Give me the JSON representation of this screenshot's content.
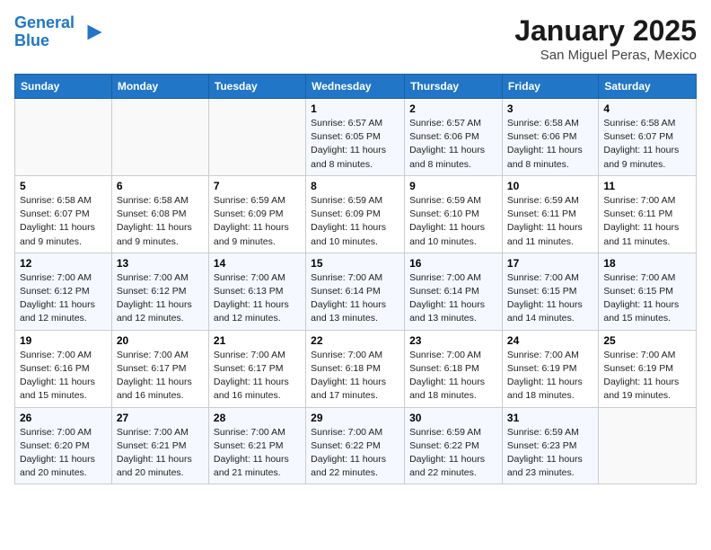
{
  "header": {
    "logo_line1": "General",
    "logo_line2": "Blue",
    "month_year": "January 2025",
    "location": "San Miguel Peras, Mexico"
  },
  "weekdays": [
    "Sunday",
    "Monday",
    "Tuesday",
    "Wednesday",
    "Thursday",
    "Friday",
    "Saturday"
  ],
  "weeks": [
    [
      {
        "day": "",
        "info": ""
      },
      {
        "day": "",
        "info": ""
      },
      {
        "day": "",
        "info": ""
      },
      {
        "day": "1",
        "info": "Sunrise: 6:57 AM\nSunset: 6:05 PM\nDaylight: 11 hours and 8 minutes."
      },
      {
        "day": "2",
        "info": "Sunrise: 6:57 AM\nSunset: 6:06 PM\nDaylight: 11 hours and 8 minutes."
      },
      {
        "day": "3",
        "info": "Sunrise: 6:58 AM\nSunset: 6:06 PM\nDaylight: 11 hours and 8 minutes."
      },
      {
        "day": "4",
        "info": "Sunrise: 6:58 AM\nSunset: 6:07 PM\nDaylight: 11 hours and 9 minutes."
      }
    ],
    [
      {
        "day": "5",
        "info": "Sunrise: 6:58 AM\nSunset: 6:07 PM\nDaylight: 11 hours and 9 minutes."
      },
      {
        "day": "6",
        "info": "Sunrise: 6:58 AM\nSunset: 6:08 PM\nDaylight: 11 hours and 9 minutes."
      },
      {
        "day": "7",
        "info": "Sunrise: 6:59 AM\nSunset: 6:09 PM\nDaylight: 11 hours and 9 minutes."
      },
      {
        "day": "8",
        "info": "Sunrise: 6:59 AM\nSunset: 6:09 PM\nDaylight: 11 hours and 10 minutes."
      },
      {
        "day": "9",
        "info": "Sunrise: 6:59 AM\nSunset: 6:10 PM\nDaylight: 11 hours and 10 minutes."
      },
      {
        "day": "10",
        "info": "Sunrise: 6:59 AM\nSunset: 6:11 PM\nDaylight: 11 hours and 11 minutes."
      },
      {
        "day": "11",
        "info": "Sunrise: 7:00 AM\nSunset: 6:11 PM\nDaylight: 11 hours and 11 minutes."
      }
    ],
    [
      {
        "day": "12",
        "info": "Sunrise: 7:00 AM\nSunset: 6:12 PM\nDaylight: 11 hours and 12 minutes."
      },
      {
        "day": "13",
        "info": "Sunrise: 7:00 AM\nSunset: 6:12 PM\nDaylight: 11 hours and 12 minutes."
      },
      {
        "day": "14",
        "info": "Sunrise: 7:00 AM\nSunset: 6:13 PM\nDaylight: 11 hours and 12 minutes."
      },
      {
        "day": "15",
        "info": "Sunrise: 7:00 AM\nSunset: 6:14 PM\nDaylight: 11 hours and 13 minutes."
      },
      {
        "day": "16",
        "info": "Sunrise: 7:00 AM\nSunset: 6:14 PM\nDaylight: 11 hours and 13 minutes."
      },
      {
        "day": "17",
        "info": "Sunrise: 7:00 AM\nSunset: 6:15 PM\nDaylight: 11 hours and 14 minutes."
      },
      {
        "day": "18",
        "info": "Sunrise: 7:00 AM\nSunset: 6:15 PM\nDaylight: 11 hours and 15 minutes."
      }
    ],
    [
      {
        "day": "19",
        "info": "Sunrise: 7:00 AM\nSunset: 6:16 PM\nDaylight: 11 hours and 15 minutes."
      },
      {
        "day": "20",
        "info": "Sunrise: 7:00 AM\nSunset: 6:17 PM\nDaylight: 11 hours and 16 minutes."
      },
      {
        "day": "21",
        "info": "Sunrise: 7:00 AM\nSunset: 6:17 PM\nDaylight: 11 hours and 16 minutes."
      },
      {
        "day": "22",
        "info": "Sunrise: 7:00 AM\nSunset: 6:18 PM\nDaylight: 11 hours and 17 minutes."
      },
      {
        "day": "23",
        "info": "Sunrise: 7:00 AM\nSunset: 6:18 PM\nDaylight: 11 hours and 18 minutes."
      },
      {
        "day": "24",
        "info": "Sunrise: 7:00 AM\nSunset: 6:19 PM\nDaylight: 11 hours and 18 minutes."
      },
      {
        "day": "25",
        "info": "Sunrise: 7:00 AM\nSunset: 6:19 PM\nDaylight: 11 hours and 19 minutes."
      }
    ],
    [
      {
        "day": "26",
        "info": "Sunrise: 7:00 AM\nSunset: 6:20 PM\nDaylight: 11 hours and 20 minutes."
      },
      {
        "day": "27",
        "info": "Sunrise: 7:00 AM\nSunset: 6:21 PM\nDaylight: 11 hours and 20 minutes."
      },
      {
        "day": "28",
        "info": "Sunrise: 7:00 AM\nSunset: 6:21 PM\nDaylight: 11 hours and 21 minutes."
      },
      {
        "day": "29",
        "info": "Sunrise: 7:00 AM\nSunset: 6:22 PM\nDaylight: 11 hours and 22 minutes."
      },
      {
        "day": "30",
        "info": "Sunrise: 6:59 AM\nSunset: 6:22 PM\nDaylight: 11 hours and 22 minutes."
      },
      {
        "day": "31",
        "info": "Sunrise: 6:59 AM\nSunset: 6:23 PM\nDaylight: 11 hours and 23 minutes."
      },
      {
        "day": "",
        "info": ""
      }
    ]
  ]
}
